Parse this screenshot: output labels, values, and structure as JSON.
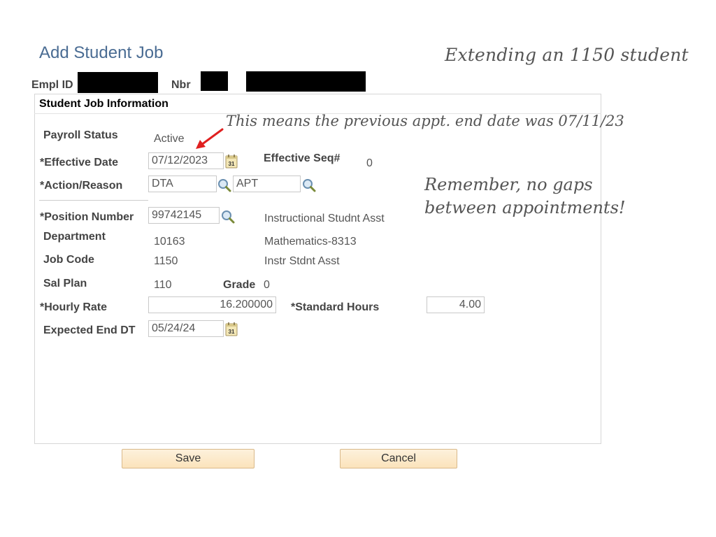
{
  "page": {
    "title": "Add Student Job"
  },
  "annotations": {
    "top_right": "Extending an 1150 student",
    "previous_end": "This means the previous appt. end date was 07/11/23",
    "reminder_line1": "Remember, no gaps",
    "reminder_line2": "between appointments!",
    "arrow_color": "#e02020"
  },
  "header": {
    "empl_id_label": "Empl ID",
    "empl_id_value": "[redacted]",
    "nbr_label": "Nbr",
    "nbr_value": "[redacted]",
    "name_value": "[redacted]"
  },
  "panel": {
    "title": "Student Job Information",
    "payroll_status_label": "Payroll Status",
    "payroll_status_value": "Active",
    "effective_date_label": "*Effective Date",
    "effective_date_value": "07/12/2023",
    "effective_seq_label": "Effective Seq#",
    "effective_seq_value": "0",
    "action_reason_label": "*Action/Reason",
    "action_value": "DTA",
    "reason_value": "APT",
    "position_number_label": "*Position Number",
    "position_number_value": "99742145",
    "position_desc": "Instructional Studnt Asst",
    "department_label": "Department",
    "department_value": "10163",
    "department_desc": "Mathematics-8313",
    "job_code_label": "Job Code",
    "job_code_value": "1150",
    "job_code_desc": "Instr Stdnt Asst",
    "sal_plan_label": "Sal Plan",
    "sal_plan_value": "110",
    "grade_label": "Grade",
    "grade_value": "0",
    "hourly_rate_label": "*Hourly Rate",
    "hourly_rate_value": "16.200000",
    "standard_hours_label": "*Standard Hours",
    "standard_hours_value": "4.00",
    "expected_end_label": "Expected End DT",
    "expected_end_value": "05/24/24",
    "calendar_icon_text": "31"
  },
  "buttons": {
    "save": "Save",
    "cancel": "Cancel"
  },
  "colors": {
    "title": "#4a6c93",
    "button_bg": "#fbe3bb",
    "button_border": "#d9b98a"
  }
}
